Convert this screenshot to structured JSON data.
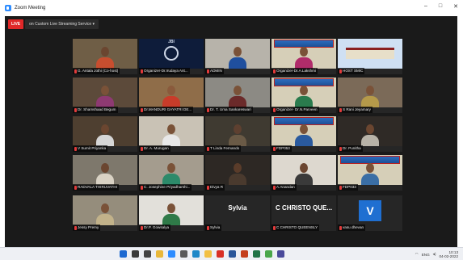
{
  "window": {
    "title": "Zoom Meeting",
    "minimize": "–",
    "maximize": "□",
    "close": "✕"
  },
  "meeting": {
    "live_badge": "LIVE",
    "stream_status": "on Custom Live Streaming Service ▾"
  },
  "participants": [
    {
      "name": "G. Antala Jothi (Co-host)",
      "kind": "person",
      "bg": "#6f5e46",
      "shirt": "#c84e2f",
      "skin": "#6b4630"
    },
    {
      "name": "Organizer-Dr.Irudaya Ant...",
      "kind": "logo",
      "bg": "#0e1c3a",
      "logo_text": "JBI"
    },
    {
      "name": "ADMIN",
      "kind": "person",
      "bg": "#b7b3aa",
      "shirt": "#1f4f9e",
      "skin": "#7a5238"
    },
    {
      "name": "Organizer-Dr.A.Lakshmi",
      "kind": "banner",
      "bg": "#d6cfb8",
      "shirt": "#b02c6a",
      "skin": "#7a5238"
    },
    {
      "name": "HOST SMIC",
      "kind": "building",
      "bg": "#cfe0f3"
    },
    {
      "name": "Dr. Shamshaad Begum",
      "kind": "person",
      "bg": "#5c4a3a",
      "shirt": "#8e3a72",
      "skin": "#7a5238"
    },
    {
      "name": "Dr.MANDURI GAYATRI DE...",
      "kind": "person",
      "bg": "#8f6d49",
      "shirt": "#c83c2a",
      "skin": "#8a5a3c"
    },
    {
      "name": "Dr. T. Uma Sankareswari",
      "kind": "person",
      "bg": "#8c8a84",
      "shirt": "#6b2a2a",
      "skin": "#7a5238"
    },
    {
      "name": "Organizer- Dr.N.Parveen",
      "kind": "banner",
      "bg": "#d6cfb8",
      "shirt": "#2a7b4d",
      "skin": "#7a5238"
    },
    {
      "name": "S Rani Jeyamary",
      "kind": "person",
      "bg": "#7b6a58",
      "shirt": "#b59a4a",
      "skin": "#7a5238"
    },
    {
      "name": "V Sumit Priyanka",
      "kind": "person",
      "bg": "#4e3f30",
      "shirt": "#d6d6d6",
      "skin": "#6b4630"
    },
    {
      "name": "Dr. A. Murugan",
      "kind": "person",
      "bg": "#c9c2b5",
      "shirt": "#e8e8e8",
      "skin": "#7a5238"
    },
    {
      "name": "T Linda Fernando",
      "kind": "person",
      "bg": "#3f3a31",
      "shirt": "#6a5a46",
      "skin": "#5e4030"
    },
    {
      "name": "FDP053",
      "kind": "banner",
      "bg": "#d6cfb8",
      "shirt": "#2a5a9e",
      "skin": "#7a5238"
    },
    {
      "name": "Dr. Punitha",
      "kind": "person",
      "bg": "#2f2a26",
      "shirt": "#b8b3a8",
      "skin": "#6b4630"
    },
    {
      "name": "RADVALA THIRUVATHI",
      "kind": "person",
      "bg": "#7e786c",
      "shirt": "#d9d2c4",
      "skin": "#6b4630"
    },
    {
      "name": "C. Josephine Priyadharshi...",
      "kind": "person",
      "bg": "#a49c8e",
      "shirt": "#2c8a6a",
      "skin": "#7a5238"
    },
    {
      "name": "Divya R",
      "kind": "person",
      "bg": "#2d2824",
      "shirt": "#4a3a2e",
      "skin": "#5a3c2a"
    },
    {
      "name": "A.Anandan",
      "kind": "person",
      "bg": "#ddd8cf",
      "shirt": "#3a3a3a",
      "skin": "#6b4630"
    },
    {
      "name": "FDP033",
      "kind": "banner",
      "bg": "#d6cfb8",
      "shirt": "#3a6ea5",
      "skin": "#7a5238"
    },
    {
      "name": "Jessy Premy",
      "kind": "person",
      "bg": "#958d7c",
      "shirt": "#c2b28a",
      "skin": "#7a5238"
    },
    {
      "name": "Dr.P. Gowsalya",
      "kind": "person",
      "bg": "#e2e0da",
      "shirt": "#2f7a48",
      "skin": "#7a5238"
    },
    {
      "name": "Sylvia",
      "kind": "text",
      "bg": "#262626",
      "display_name": "Sylvia"
    },
    {
      "name": "C CHRISTO QUEENSLY",
      "kind": "text",
      "bg": "#262626",
      "display_name": "C CHRISTO QUE..."
    },
    {
      "name": "vasu dhevan",
      "kind": "letter",
      "bg": "#262626",
      "letter": "V"
    }
  ],
  "taskbar": {
    "icons": [
      {
        "name": "windows-start-icon",
        "color": "#1e6ad1"
      },
      {
        "name": "search-icon",
        "color": "#3a3a3a"
      },
      {
        "name": "task-view-icon",
        "color": "#444"
      },
      {
        "name": "file-explorer-icon",
        "color": "#e9b83a"
      },
      {
        "name": "zoom-icon",
        "color": "#2d8cff"
      },
      {
        "name": "settings-icon",
        "color": "#5a5a5a"
      },
      {
        "name": "edge-icon",
        "color": "#1e88c8"
      },
      {
        "name": "folder-icon",
        "color": "#f2c044"
      },
      {
        "name": "gmail-icon",
        "color": "#d93025"
      },
      {
        "name": "word-icon",
        "color": "#2b579a"
      },
      {
        "name": "powerpoint-icon",
        "color": "#c43e1c"
      },
      {
        "name": "excel-icon",
        "color": "#217346"
      },
      {
        "name": "chrome-icon",
        "color": "#4aa64a"
      },
      {
        "name": "camera-icon",
        "color": "#4a4a9a"
      }
    ],
    "lang": "ENG",
    "time": "10:13",
    "date": "04-02-2022"
  }
}
